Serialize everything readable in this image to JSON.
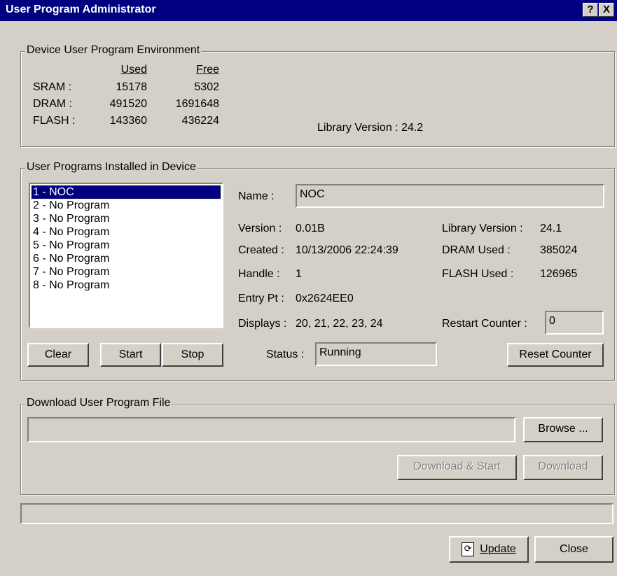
{
  "window": {
    "title": "User Program Administrator",
    "help_label": "?",
    "close_label": "X"
  },
  "environment": {
    "legend": "Device User Program Environment",
    "col_used": "Used",
    "col_free": "Free",
    "rows": [
      {
        "label": "SRAM :",
        "used": "15178",
        "free": "5302"
      },
      {
        "label": "DRAM :",
        "used": "491520",
        "free": "1691648"
      },
      {
        "label": "FLASH :",
        "used": "143360",
        "free": "436224"
      }
    ],
    "library_version": "Library Version : 24.2"
  },
  "installed": {
    "legend": "User Programs Installed in Device",
    "programs": [
      "1 - NOC",
      "2 - No Program",
      "3 - No Program",
      "4 - No Program",
      "5 - No Program",
      "6 - No Program",
      "7 - No Program",
      "8 - No Program"
    ],
    "name_label": "Name :",
    "name_value": "NOC",
    "version_label": "Version :",
    "version_value": "0.01B",
    "created_label": "Created :",
    "created_value": "10/13/2006 22:24:39",
    "handle_label": "Handle :",
    "handle_value": "1",
    "entry_label": "Entry Pt :",
    "entry_value": "0x2624EE0",
    "displays_label": "Displays :",
    "displays_value": "20, 21, 22, 23, 24",
    "lib_label": "Library Version :",
    "lib_value": "24.1",
    "dram_label": "DRAM Used :",
    "dram_value": "385024",
    "flash_label": "FLASH Used :",
    "flash_value": "126965",
    "restart_label": "Restart Counter :",
    "restart_value": "0",
    "status_label": "Status :",
    "status_value": "Running",
    "clear_label": "Clear",
    "start_label": "Start",
    "stop_label": "Stop",
    "reset_label": "Reset Counter"
  },
  "download": {
    "legend": "Download User Program File",
    "path_value": "",
    "browse_label": "Browse ...",
    "download_start_label": "Download & Start",
    "download_label": "Download"
  },
  "footer": {
    "update_label": "Update",
    "close_label": "Close"
  }
}
